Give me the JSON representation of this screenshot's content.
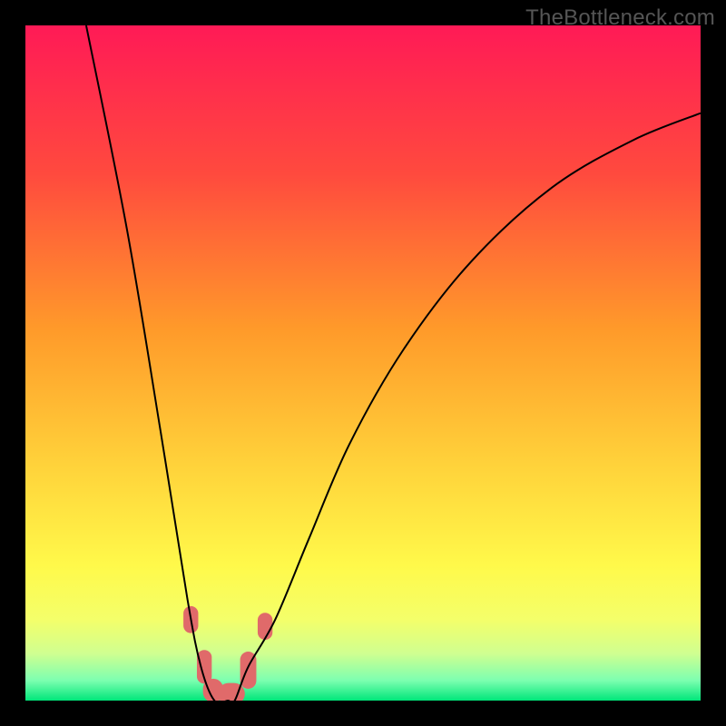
{
  "watermark": "TheBottleneck.com",
  "chart_data": {
    "type": "line",
    "title": "",
    "xlabel": "",
    "ylabel": "",
    "xlim": [
      0,
      100
    ],
    "ylim": [
      0,
      100
    ],
    "background_gradient_stops": [
      {
        "offset": 0,
        "color": "#ff1a56"
      },
      {
        "offset": 22,
        "color": "#ff4a3e"
      },
      {
        "offset": 45,
        "color": "#ff9a2a"
      },
      {
        "offset": 65,
        "color": "#ffd23a"
      },
      {
        "offset": 80,
        "color": "#fff94a"
      },
      {
        "offset": 88,
        "color": "#f4ff6a"
      },
      {
        "offset": 93,
        "color": "#d0ff90"
      },
      {
        "offset": 97,
        "color": "#7dffb0"
      },
      {
        "offset": 100,
        "color": "#00e67a"
      }
    ],
    "series": [
      {
        "name": "bottleneck-curve",
        "type": "smooth",
        "color": "#000000",
        "stroke_width": 2,
        "x": [
          9,
          15,
          20,
          24,
          26,
          28,
          30,
          31,
          33,
          37,
          42,
          48,
          56,
          66,
          78,
          90,
          100
        ],
        "y": [
          100,
          70,
          40,
          15,
          5,
          0,
          0,
          0,
          5,
          12,
          24,
          38,
          52,
          65,
          76,
          83,
          87
        ]
      }
    ],
    "markers": {
      "name": "highlight-points",
      "color": "#e06a6a",
      "shape": "rounded",
      "points": [
        {
          "x": 24.5,
          "y": 12,
          "w": 2.2,
          "h": 4
        },
        {
          "x": 26.5,
          "y": 5,
          "w": 2.2,
          "h": 5
        },
        {
          "x": 27.8,
          "y": 1.5,
          "w": 3.0,
          "h": 3.5
        },
        {
          "x": 30.5,
          "y": 1.0,
          "w": 4.0,
          "h": 3.2
        },
        {
          "x": 33.0,
          "y": 4.5,
          "w": 2.4,
          "h": 5.5
        },
        {
          "x": 35.5,
          "y": 11,
          "w": 2.2,
          "h": 4
        }
      ]
    }
  }
}
